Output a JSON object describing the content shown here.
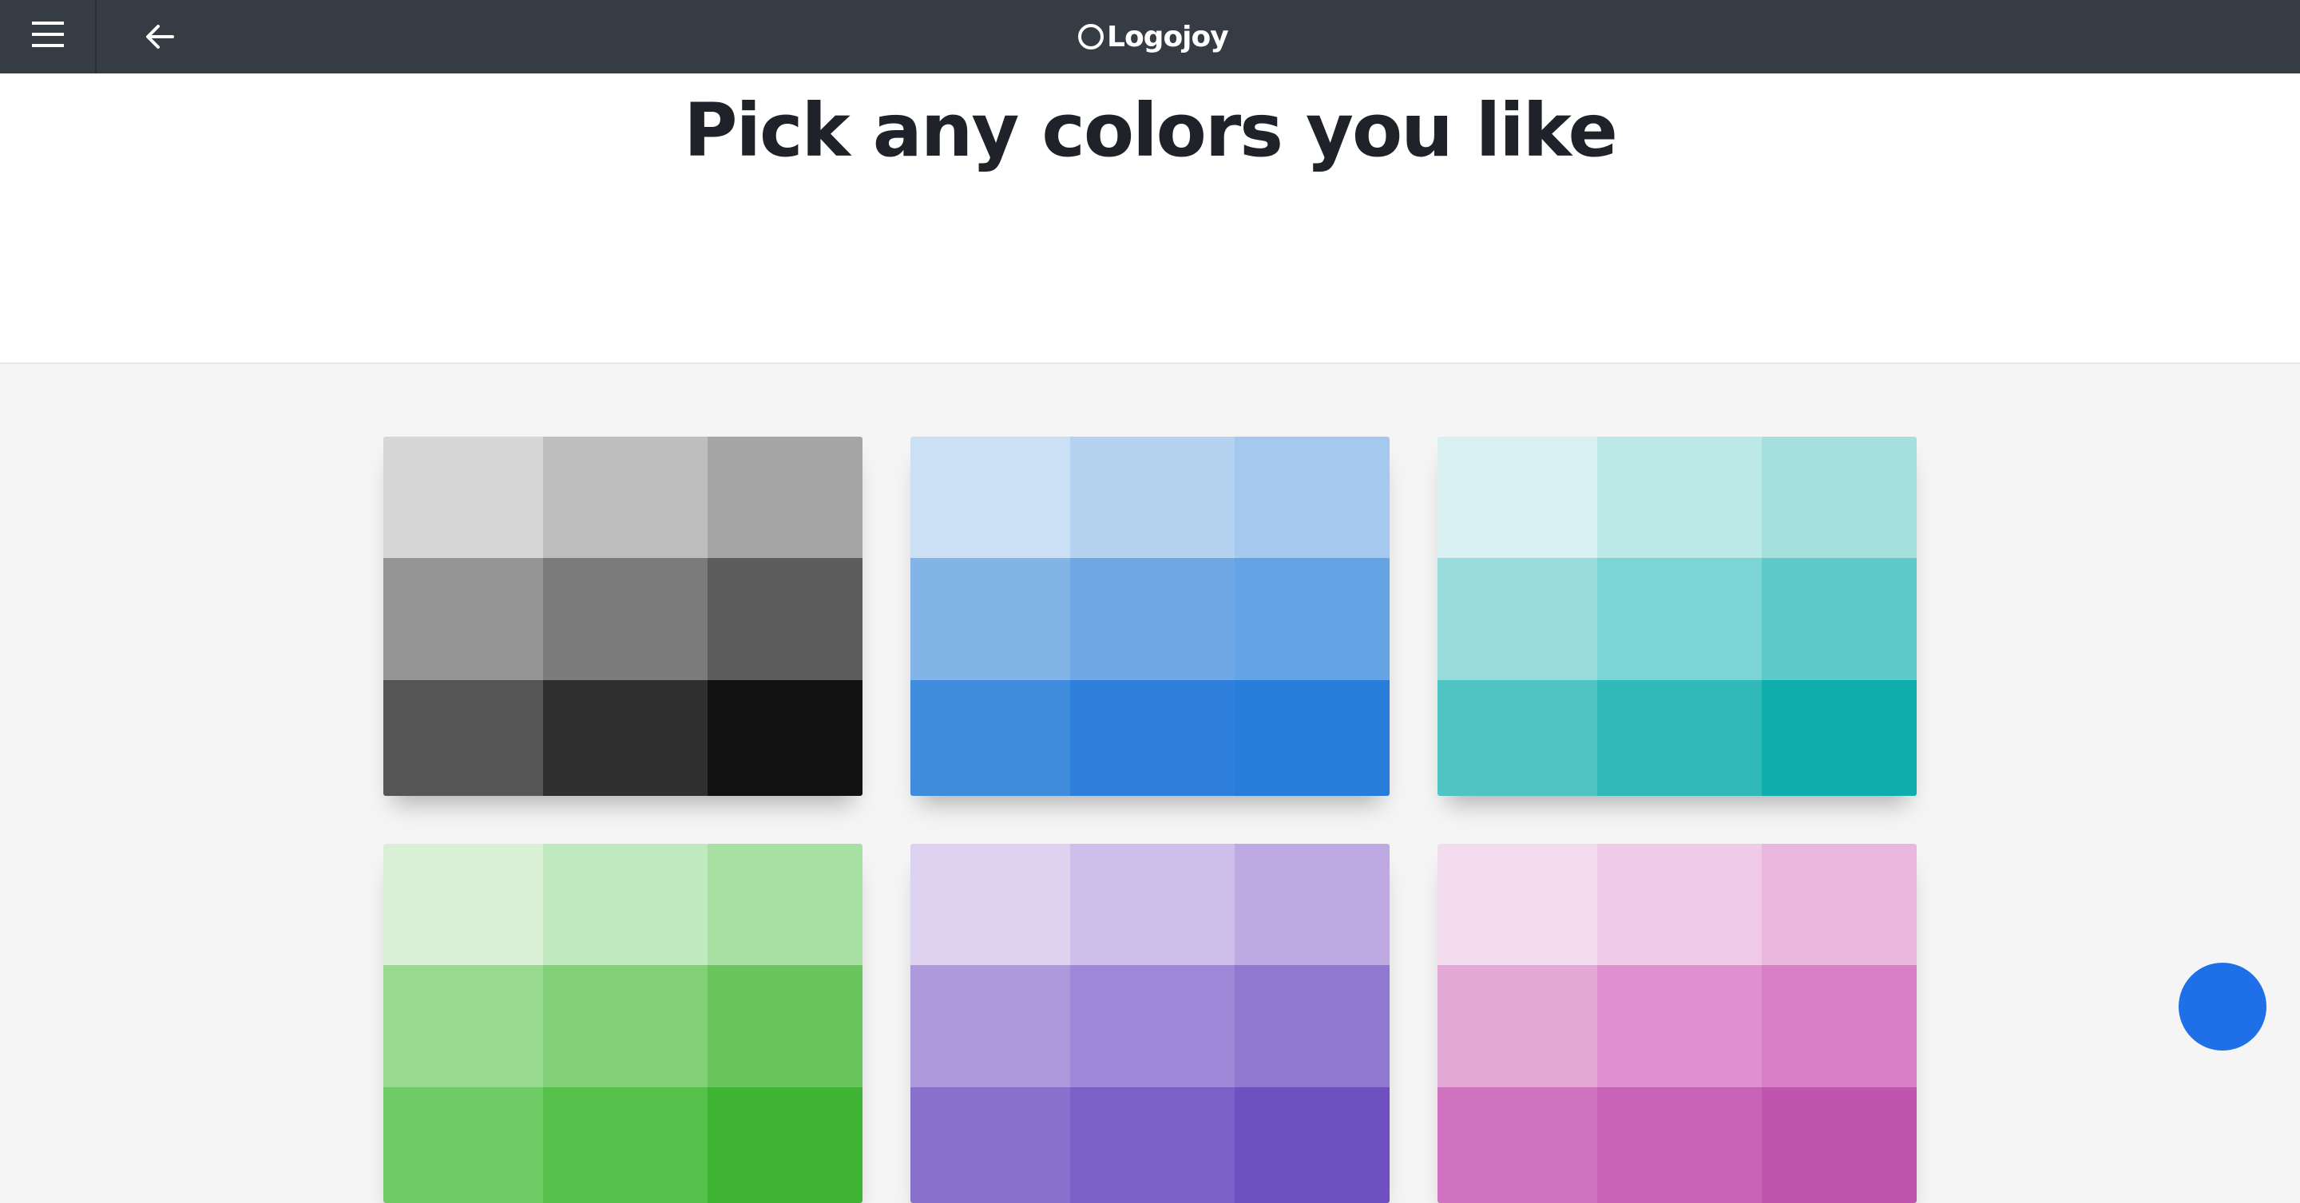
{
  "topbar": {
    "menu_icon": "hamburger-menu-icon",
    "back_icon": "arrow-left-icon",
    "logo_icon": "circle-logo-icon",
    "logo_text": "Logojoy",
    "background": "#363c44"
  },
  "header": {
    "title": "Pick any colors you like"
  },
  "palettes": [
    {
      "name": "grays",
      "swatches": [
        "#d6d6d6",
        "#bebebe",
        "#a6a6a6",
        "#959595",
        "#7b7b7b",
        "#5d5d5d",
        "#555555",
        "#2f2f2f",
        "#121212"
      ]
    },
    {
      "name": "blues",
      "swatches": [
        "#cbdff5",
        "#b5d2f1",
        "#a4c8ee",
        "#83b4e7",
        "#70a8e6",
        "#64a3e4",
        "#3f8bdc",
        "#2e80dc",
        "#277dd9"
      ]
    },
    {
      "name": "teals",
      "swatches": [
        "#d8f0f1",
        "#bde8e8",
        "#a5e0df",
        "#97dcdb",
        "#7ad5d4",
        "#5dc9c8",
        "#4fc4c2",
        "#31b9b8",
        "#10adad"
      ]
    },
    {
      "name": "greens",
      "swatches": [
        "#daf0d6",
        "#c0e9c0",
        "#a8e0a4",
        "#98d88f",
        "#82d078",
        "#6ac55f",
        "#6fcb66",
        "#55c04a",
        "#3fb434"
      ]
    },
    {
      "name": "purples",
      "swatches": [
        "#ddd2f0",
        "#cdbfe9",
        "#bea9e2",
        "#ae99dd",
        "#9f88d7",
        "#9078d1",
        "#8a70cd",
        "#7d60c7",
        "#6f50c0"
      ]
    },
    {
      "name": "pinks",
      "swatches": [
        "#f3dcf0",
        "#efcbe8",
        "#e9b7de",
        "#e4a8d7",
        "#e08fd0",
        "#d87fc8",
        "#d072c0",
        "#c864b8",
        "#c055b0"
      ]
    }
  ],
  "chat": {
    "icon": "chat-bubble-icon",
    "color": "#1f6fe8"
  }
}
